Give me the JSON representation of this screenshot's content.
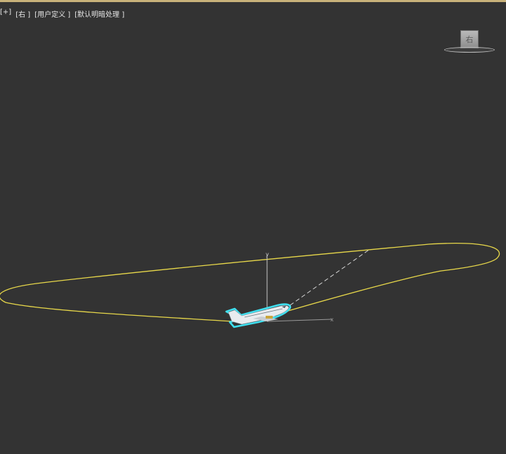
{
  "viewport": {
    "labels": [
      "[+]",
      "[右 ]",
      "[用户定义 ]",
      "[默认明暗处理 ]"
    ]
  },
  "viewcube": {
    "face_label": "右"
  },
  "colors": {
    "background": "#333333",
    "path_spline": "#e8d84a",
    "selection_outline": "#3fe0f0",
    "gizmo_axis": "#c8c8c8",
    "top_border": "#c8b27a"
  },
  "icons": {
    "airplane": "airplane-model",
    "gizmo": "transform-gizmo-icon"
  }
}
